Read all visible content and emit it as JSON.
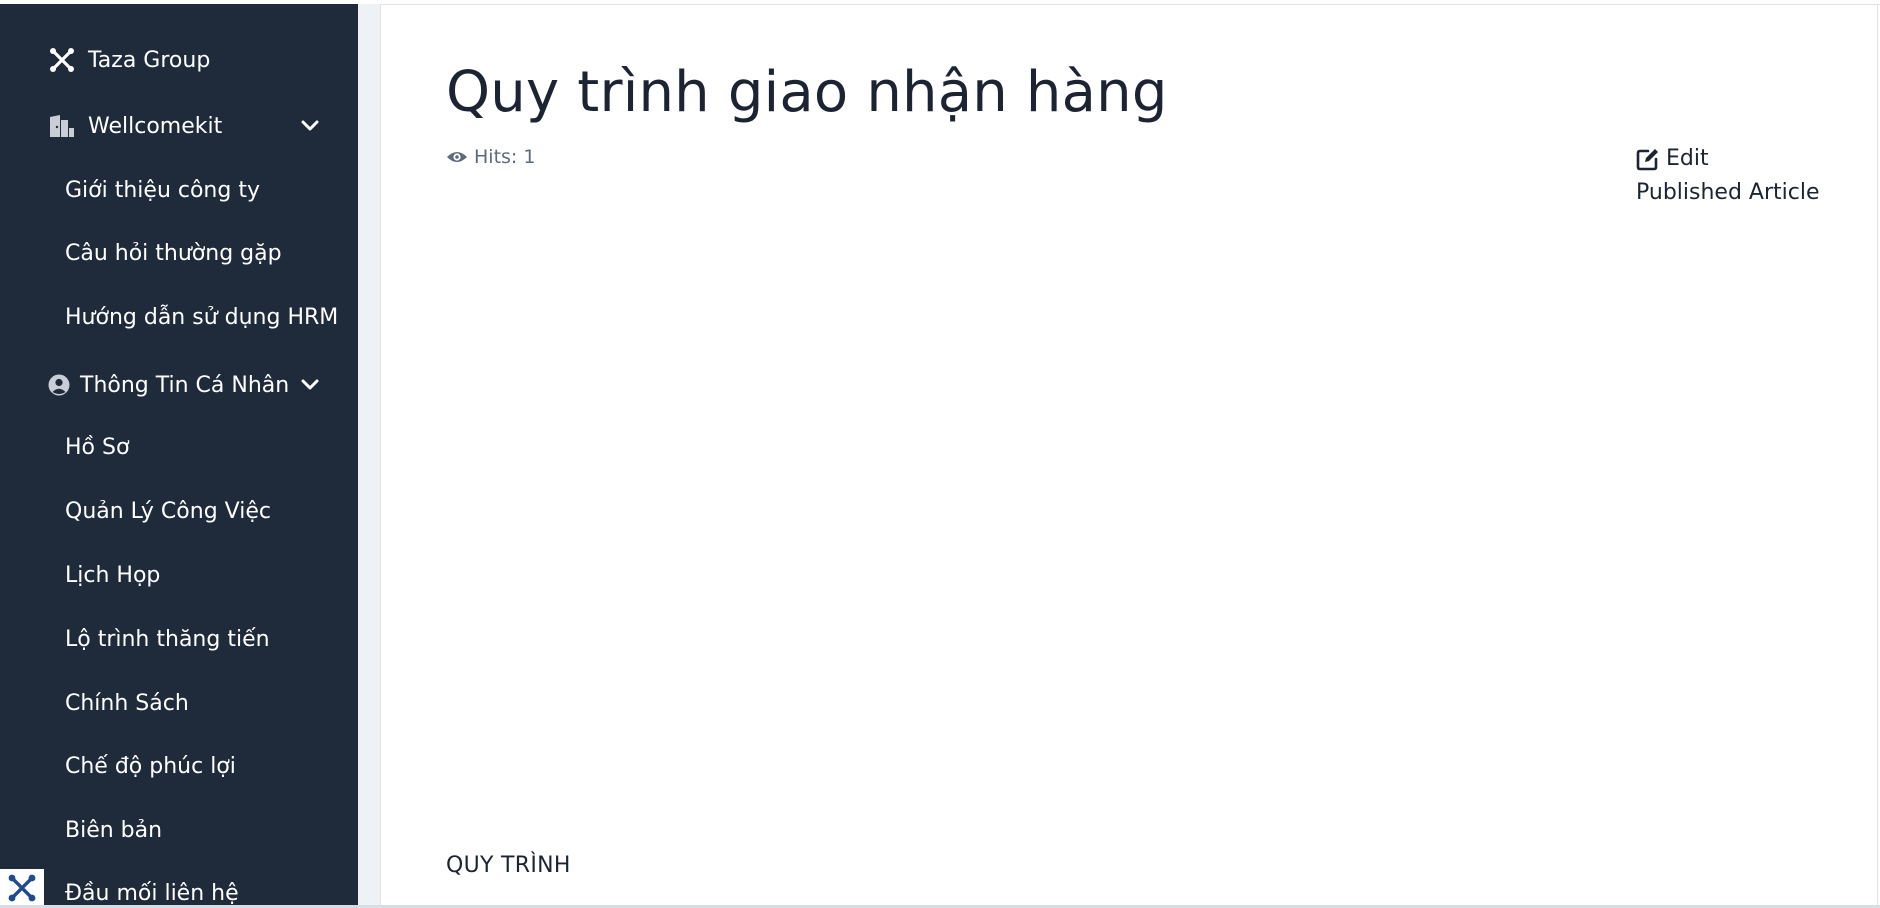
{
  "sidebar": {
    "brand": {
      "label": "Taza Group",
      "icon": "brand-x-icon"
    },
    "groups": [
      {
        "label": "Wellcomekit",
        "icon": "building-door-icon",
        "items": [
          {
            "label": "Giới thiệu công ty"
          },
          {
            "label": "Câu hỏi thường gặp"
          },
          {
            "label": "Hướng dẫn sử dụng HRM"
          }
        ]
      },
      {
        "label": "Thông Tin Cá Nhân",
        "icon": "user-circle-icon",
        "items": [
          {
            "label": "Hồ Sơ"
          },
          {
            "label": "Quản Lý Công Việc"
          },
          {
            "label": "Lịch Họp"
          },
          {
            "label": "Lộ trình thăng tiến"
          },
          {
            "label": "Chính Sách"
          },
          {
            "label": "Chế độ phúc lợi"
          },
          {
            "label": "Biên bản"
          },
          {
            "label": "Đầu mối liên hệ"
          }
        ]
      }
    ]
  },
  "article": {
    "title": "Quy trình giao nhận hàng",
    "hits": "Hits: 1",
    "edit_label": "Edit",
    "status": "Published Article",
    "section_heading": "QUY TRÌNH"
  },
  "colors": {
    "sidebar_bg": "#1f2a3b",
    "text_dark": "#1c2434",
    "muted": "#5d6b7d"
  }
}
